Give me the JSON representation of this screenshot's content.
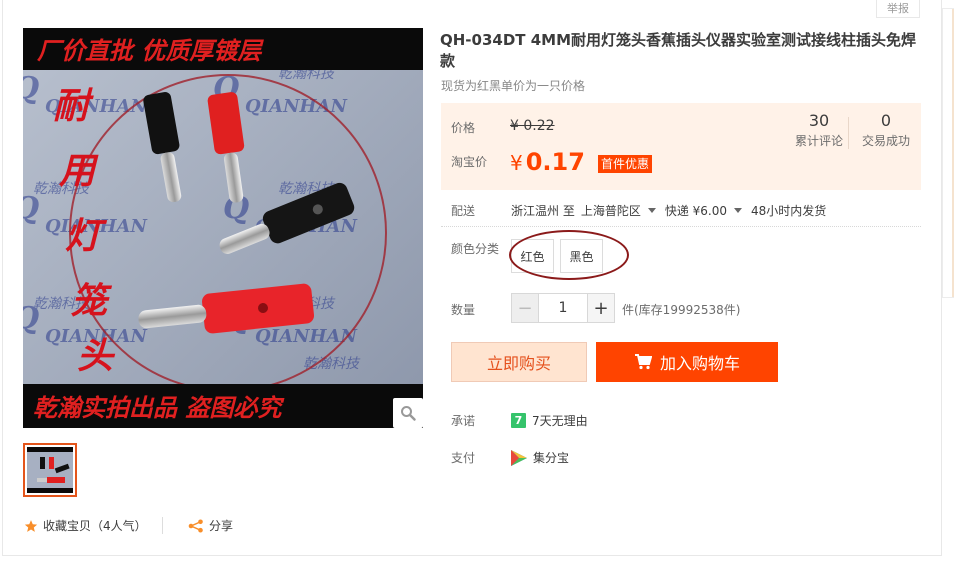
{
  "report_label": "举报",
  "product": {
    "title": "QH-034DT 4MM耐用灯笼头香蕉插头仪器实验室测试接线柱插头免焊款",
    "subtitle": "现货为红黑单价为一只价格"
  },
  "image": {
    "banner_top": "厂价直批    优质厚镀层",
    "banner_bottom": "乾瀚实拍出品    盗图必究",
    "vertical_text": "耐用灯笼头",
    "watermark_cn": "乾瀚科技",
    "watermark_en": "QIANHAN"
  },
  "price": {
    "label": "价格",
    "original": "¥ 0.22",
    "tb_label": "淘宝价",
    "currency": "¥",
    "value": "0.17",
    "promo": "首件优惠"
  },
  "stats": {
    "reviews_count": "30",
    "reviews_label": "累计评论",
    "deals_count": "0",
    "deals_label": "交易成功"
  },
  "shipping": {
    "label": "配送",
    "from": "浙江温州 至",
    "to": "上海普陀区",
    "method": "快递 ¥6.00",
    "time": "48小时内发货"
  },
  "sku": {
    "label": "颜色分类",
    "options": [
      "红色",
      "黑色"
    ]
  },
  "quantity": {
    "label": "数量",
    "value": "1",
    "minus": "−",
    "plus": "+",
    "stock": "件(库存19992538件)"
  },
  "buttons": {
    "buy_now": "立即购买",
    "add_cart": "加入购物车"
  },
  "promise": {
    "label": "承诺",
    "badge": "7",
    "text": "7天无理由"
  },
  "payment": {
    "label": "支付",
    "text": "集分宝"
  },
  "footer": {
    "favorite": "收藏宝贝（4人气）",
    "share": "分享"
  },
  "colors": {
    "accent": "#ff4400",
    "price_bg": "#fff2e8",
    "buy_now_bg": "#ffe4d0"
  }
}
